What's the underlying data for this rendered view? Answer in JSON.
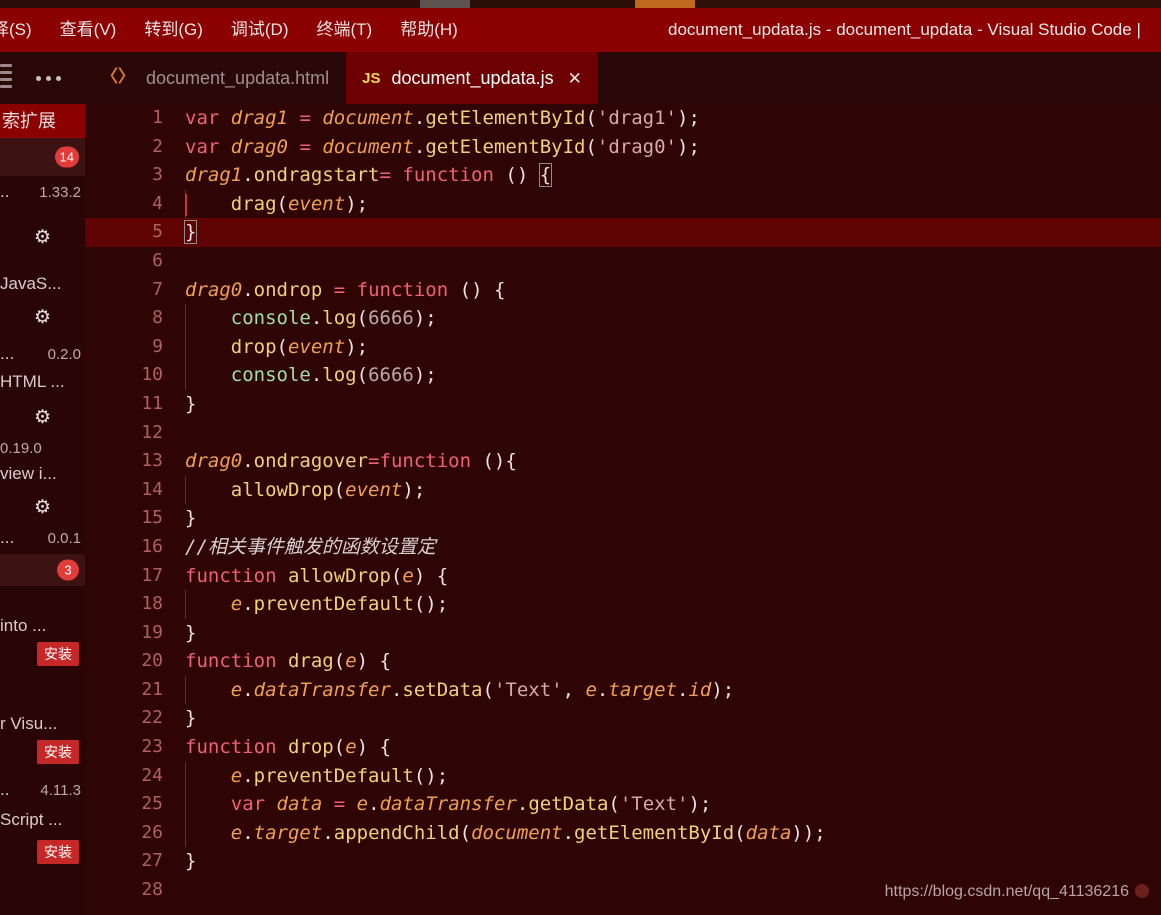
{
  "window": {
    "title": "document_updata.js - document_updata - Visual Studio Code |",
    "accent_titlebar": "#8b0000",
    "editor_bg": "#2e0404",
    "current_line_bg": "#5e0202"
  },
  "menubar": {
    "items": [
      {
        "label": "择(S)"
      },
      {
        "label": "查看(V)"
      },
      {
        "label": "转到(G)"
      },
      {
        "label": "调试(D)"
      },
      {
        "label": "终端(T)"
      },
      {
        "label": "帮助(H)"
      }
    ]
  },
  "sidebar": {
    "search_placeholder": "索扩展",
    "more_icon": "ellipsis-icon",
    "menu_icon": "hamburger-icon",
    "rows": [
      {
        "kind": "badge",
        "badge": "14",
        "selected": true
      },
      {
        "kind": "meta",
        "name": "..",
        "version": "1.33.2"
      },
      {
        "kind": "gear"
      },
      {
        "kind": "desc",
        "text": "JavaS..."
      },
      {
        "kind": "gear"
      },
      {
        "kind": "meta",
        "name": "...",
        "version": "0.2.0"
      },
      {
        "kind": "desc",
        "text": "HTML ..."
      },
      {
        "kind": "gear"
      },
      {
        "kind": "meta",
        "name": "",
        "version": "0.19.0"
      },
      {
        "kind": "desc",
        "text": "view i..."
      },
      {
        "kind": "gear"
      },
      {
        "kind": "meta",
        "name": "...",
        "version": "0.0.1"
      },
      {
        "kind": "badge",
        "badge": "3",
        "selected": true
      },
      {
        "kind": "desc",
        "text": "into ..."
      },
      {
        "kind": "install",
        "label": "安装"
      },
      {
        "kind": "desc",
        "text": "r Visu..."
      },
      {
        "kind": "install",
        "label": "安装"
      },
      {
        "kind": "meta",
        "name": "..",
        "version": "4.11.3"
      },
      {
        "kind": "desc",
        "text": "Script ..."
      },
      {
        "kind": "install",
        "label": "安装"
      }
    ]
  },
  "tabs": [
    {
      "label": "document_updata.html",
      "icon": "html-file-icon",
      "icon_glyph": "〈〉",
      "active": false,
      "closable": false
    },
    {
      "label": "document_updata.js",
      "icon": "js-file-icon",
      "icon_glyph": "JS",
      "active": true,
      "closable": true,
      "close_glyph": "✕"
    }
  ],
  "editor": {
    "language": "JavaScript",
    "current_line": 5,
    "total_lines_visible": 28,
    "lines": [
      {
        "n": 1,
        "indent": 0,
        "html": "<span class='k'>var</span> <span class='id'>drag1</span> <span class='op'>=</span> <span class='id'>document</span><span class='pl'>.</span><span class='fn'>getElementById</span><span class='pl'>(</span><span class='str'>'drag1'</span><span class='pl'>);</span>"
      },
      {
        "n": 2,
        "indent": 0,
        "html": "<span class='k'>var</span> <span class='id'>drag0</span> <span class='op'>=</span> <span class='id'>document</span><span class='pl'>.</span><span class='fn'>getElementById</span><span class='pl'>(</span><span class='str'>'drag0'</span><span class='pl'>);</span>"
      },
      {
        "n": 3,
        "indent": 0,
        "html": "<span class='id'>drag1</span><span class='pl'>.</span><span class='fn'>ondragstart</span><span class='op'>=</span> <span class='k'>function</span> <span class='pl'>() </span><span class='pl bracketbox'>{</span>"
      },
      {
        "n": 4,
        "indent": 1,
        "html": "    <span class='fn'>drag</span><span class='pl'>(</span><span class='id'>event</span><span class='pl'>);</span>"
      },
      {
        "n": 5,
        "indent": 0,
        "html": "<span class='pl bracketbox'>}</span>"
      },
      {
        "n": 6,
        "indent": 0,
        "html": ""
      },
      {
        "n": 7,
        "indent": 0,
        "html": "<span class='id'>drag0</span><span class='pl'>.</span><span class='fn'>ondrop</span> <span class='op'>=</span> <span class='k'>function</span> <span class='pl'>() {</span>"
      },
      {
        "n": 8,
        "indent": 1,
        "html": "    <span class='cs'>console</span><span class='pl'>.</span><span class='fn'>log</span><span class='pl'>(</span><span class='num'>6666</span><span class='pl'>);</span>"
      },
      {
        "n": 9,
        "indent": 1,
        "html": "    <span class='fn'>drop</span><span class='pl'>(</span><span class='id'>event</span><span class='pl'>);</span>"
      },
      {
        "n": 10,
        "indent": 1,
        "html": "    <span class='cs'>console</span><span class='pl'>.</span><span class='fn'>log</span><span class='pl'>(</span><span class='num'>6666</span><span class='pl'>);</span>"
      },
      {
        "n": 11,
        "indent": 0,
        "html": "<span class='pl'>}</span>"
      },
      {
        "n": 12,
        "indent": 0,
        "html": ""
      },
      {
        "n": 13,
        "indent": 0,
        "html": "<span class='id'>drag0</span><span class='pl'>.</span><span class='fn'>ondragover</span><span class='op'>=</span><span class='k'>function</span> <span class='pl'>(){</span>"
      },
      {
        "n": 14,
        "indent": 1,
        "html": "    <span class='fn'>allowDrop</span><span class='pl'>(</span><span class='id'>event</span><span class='pl'>);</span>"
      },
      {
        "n": 15,
        "indent": 0,
        "html": "<span class='pl'>}</span>"
      },
      {
        "n": 16,
        "indent": 0,
        "html": "<span class='cm'>//相关事件触发的函数设置定</span>"
      },
      {
        "n": 17,
        "indent": 0,
        "html": "<span class='k'>function</span> <span class='fn'>allowDrop</span><span class='pl'>(</span><span class='id'>e</span><span class='pl'>) {</span>"
      },
      {
        "n": 18,
        "indent": 1,
        "html": "    <span class='id'>e</span><span class='pl'>.</span><span class='fn'>preventDefault</span><span class='pl'>();</span>"
      },
      {
        "n": 19,
        "indent": 0,
        "html": "<span class='pl'>}</span>"
      },
      {
        "n": 20,
        "indent": 0,
        "html": "<span class='k'>function</span> <span class='fn'>drag</span><span class='pl'>(</span><span class='id'>e</span><span class='pl'>) {</span>"
      },
      {
        "n": 21,
        "indent": 1,
        "html": "    <span class='id'>e</span><span class='pl'>.</span><span class='id'>dataTransfer</span><span class='pl'>.</span><span class='fn'>setData</span><span class='pl'>(</span><span class='str'>'Text'</span><span class='pl'>, </span><span class='id'>e</span><span class='pl'>.</span><span class='id'>target</span><span class='pl'>.</span><span class='id'>id</span><span class='pl'>);</span>"
      },
      {
        "n": 22,
        "indent": 0,
        "html": "<span class='pl'>}</span>"
      },
      {
        "n": 23,
        "indent": 0,
        "html": "<span class='k'>function</span> <span class='fn'>drop</span><span class='pl'>(</span><span class='id'>e</span><span class='pl'>) {</span>"
      },
      {
        "n": 24,
        "indent": 1,
        "html": "    <span class='id'>e</span><span class='pl'>.</span><span class='fn'>preventDefault</span><span class='pl'>();</span>"
      },
      {
        "n": 25,
        "indent": 1,
        "html": "    <span class='k'>var</span> <span class='id'>data</span> <span class='op'>=</span> <span class='id'>e</span><span class='pl'>.</span><span class='id'>dataTransfer</span><span class='pl'>.</span><span class='fn'>getData</span><span class='pl'>(</span><span class='str'>'Text'</span><span class='pl'>);</span>"
      },
      {
        "n": 26,
        "indent": 1,
        "html": "    <span class='id'>e</span><span class='pl'>.</span><span class='id'>target</span><span class='pl'>.</span><span class='fn'>appendChild</span><span class='pl'>(</span><span class='id'>document</span><span class='pl'>.</span><span class='fn'>getElementById</span><span class='pl'>(</span><span class='id'>data</span><span class='pl'>));</span>"
      },
      {
        "n": 27,
        "indent": 0,
        "html": "<span class='pl'>}</span>"
      },
      {
        "n": 28,
        "indent": 0,
        "html": ""
      }
    ],
    "code_plain": [
      "var drag1 = document.getElementById('drag1');",
      "var drag0 = document.getElementById('drag0');",
      "drag1.ondragstart= function () {",
      "    drag(event);",
      "}",
      "",
      "drag0.ondrop = function () {",
      "    console.log(6666);",
      "    drop(event);",
      "    console.log(6666);",
      "}",
      "",
      "drag0.ondragover=function (){",
      "    allowDrop(event);",
      "}",
      "//相关事件触发的函数设置定",
      "function allowDrop(e) {",
      "    e.preventDefault();",
      "}",
      "function drag(e) {",
      "    e.dataTransfer.setData('Text', e.target.id);",
      "}",
      "function drop(e) {",
      "    e.preventDefault();",
      "    var data = e.dataTransfer.getData('Text');",
      "    e.target.appendChild(document.getElementById(data));",
      "}",
      ""
    ]
  },
  "watermark": {
    "text": "https://blog.csdn.net/qq_41136216"
  }
}
